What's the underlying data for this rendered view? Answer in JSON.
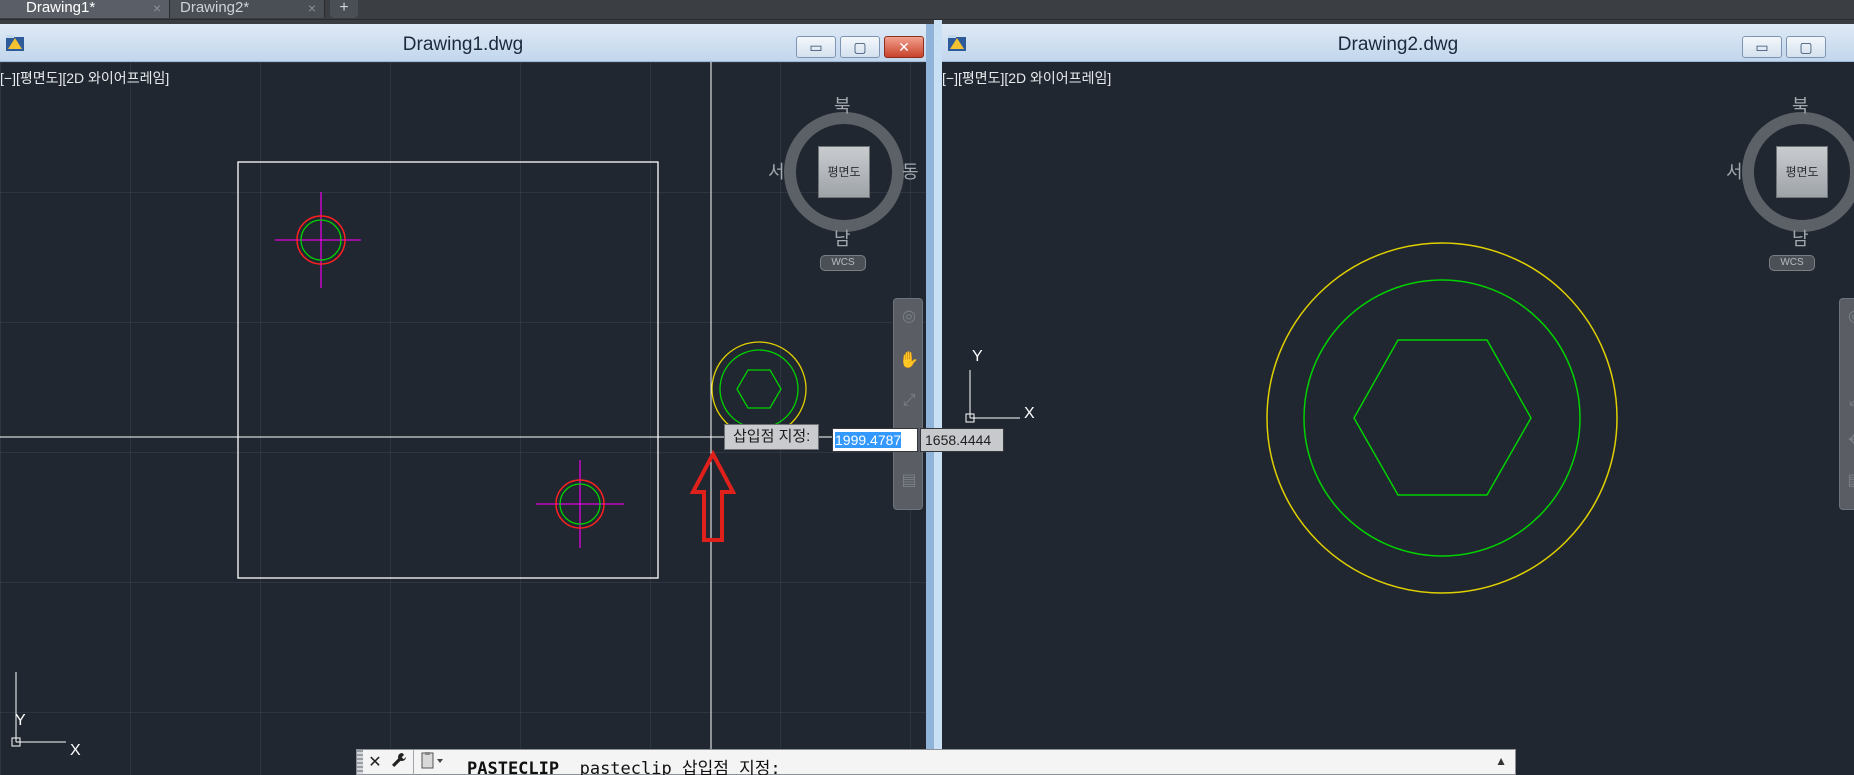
{
  "tabs": [
    {
      "label": "Drawing1*",
      "active": true
    },
    {
      "label": "Drawing2*",
      "active": false
    }
  ],
  "tab_close_glyph": "×",
  "new_tab_glyph": "+",
  "windows": [
    {
      "title": "Drawing1.dwg",
      "viewport_label": "[−][평면도][2D 와이어프레임]",
      "viewcube": {
        "north": "북",
        "south": "남",
        "west": "서",
        "east": "동",
        "face": "평면도",
        "wcs": "WCS"
      },
      "ucs": {
        "x": "X",
        "y": "Y"
      }
    },
    {
      "title": "Drawing2.dwg",
      "viewport_label": "[−][평면도][2D 와이어프레임]",
      "viewcube": {
        "north": "북",
        "south": "남",
        "west": "서",
        "east": "동",
        "face": "평면도",
        "wcs": "WCS"
      },
      "ucs": {
        "x": "X",
        "y": "Y"
      }
    }
  ],
  "window_buttons": {
    "minimize": "▭",
    "maximize": "▢",
    "close": "✕"
  },
  "dynamic_input": {
    "prompt": "삽입점 지정:",
    "x_value": "1999.4787",
    "y_value": "1658.4444"
  },
  "command_line": {
    "command": "PASTECLIP",
    "text": "  pasteclip 삽입점 지정:",
    "close_glyph": "✕",
    "wrench_glyph": "🔧",
    "up_glyph": "▲"
  },
  "icons": {
    "app": "autocad-app-icon",
    "nav": [
      "steering-wheel-icon",
      "pan-hand-icon",
      "zoom-extents-icon",
      "orbit-icon",
      "showmotion-icon"
    ],
    "annotation": "red-up-arrow-annotation"
  },
  "colors": {
    "canvas": "#212730",
    "geometry_white": "#ffffff",
    "geometry_green": "#00d100",
    "geometry_yellow": "#e0d000",
    "geometry_red": "#ff2020",
    "geometry_magenta": "#e000e0",
    "annotation_red": "#e0201a",
    "selection_blue": "#3399ff"
  }
}
